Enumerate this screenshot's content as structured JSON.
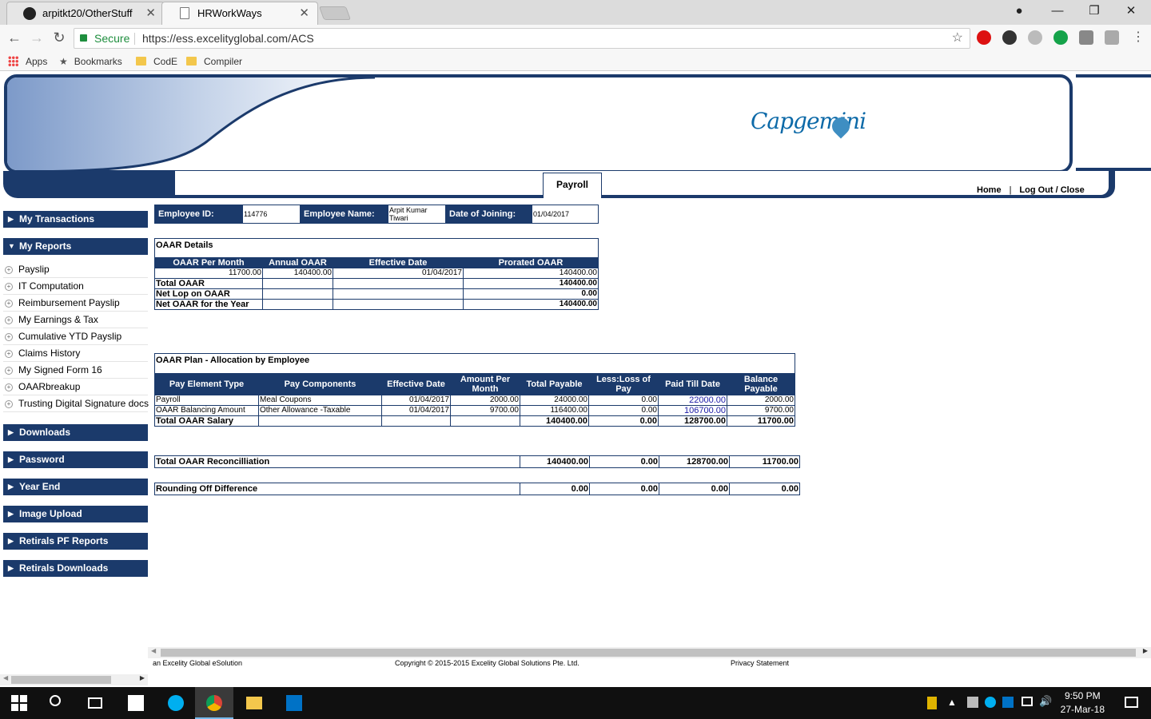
{
  "browser": {
    "tabs": [
      {
        "label": "arpitkt20/OtherStuff",
        "active": false
      },
      {
        "label": "HRWorkWays",
        "active": true
      }
    ],
    "secure_label": "Secure",
    "url": "https://ess.excelityglobal.com/ACS",
    "bookmarks": [
      "Apps",
      "Bookmarks",
      "CodE",
      "Compiler"
    ]
  },
  "header": {
    "logo_text": "Capgemini",
    "active_tab": "Payroll",
    "home_link": "Home",
    "separator": "|",
    "logout_link": "Log Out / Close"
  },
  "sidebar": {
    "sections": [
      {
        "label": "My Transactions",
        "expanded": false
      },
      {
        "label": "My Reports",
        "expanded": true
      },
      {
        "label": "Downloads",
        "expanded": false
      },
      {
        "label": "Password",
        "expanded": false
      },
      {
        "label": "Year End",
        "expanded": false
      },
      {
        "label": "Image Upload",
        "expanded": false
      },
      {
        "label": "Retirals PF Reports",
        "expanded": false
      },
      {
        "label": "Retirals Downloads",
        "expanded": false
      }
    ],
    "report_items": [
      "Payslip",
      "IT Computation",
      "Reimbursement Payslip",
      "My Earnings & Tax",
      "Cumulative YTD Payslip",
      "Claims History",
      "My Signed Form 16",
      "OAARbreakup",
      "Trusting Digital Signature docs"
    ]
  },
  "employee": {
    "id_label": "Employee ID:",
    "id": "114776",
    "name_label": "Employee Name:",
    "name_line1": "Arpit Kumar",
    "name_line2": "Tiwari",
    "doj_label": "Date of Joining:",
    "doj": "01/04/2017"
  },
  "oaar_details": {
    "title": "OAAR Details",
    "headers": [
      "OAAR Per Month",
      "Annual OAAR",
      "Effective Date",
      "Prorated OAAR"
    ],
    "row": [
      "11700.00",
      "140400.00",
      "01/04/2017",
      "140400.00"
    ],
    "totals": [
      {
        "label": "Total OAAR",
        "value": "140400.00"
      },
      {
        "label": "Net Lop on OAAR",
        "value": "0.00"
      },
      {
        "label": "Net OAAR for the Year",
        "value": "140400.00"
      }
    ]
  },
  "oaar_plan": {
    "title": "OAAR Plan - Allocation by Employee",
    "headers": [
      "Pay Element Type",
      "Pay Components",
      "Effective Date",
      "Amount Per Month",
      "Total Payable",
      "Less:Loss of Pay",
      "Paid Till Date",
      "Balance Payable"
    ],
    "rows": [
      [
        "Payroll",
        "Meal Coupons",
        "01/04/2017",
        "2000.00",
        "24000.00",
        "0.00",
        "22000.00",
        "2000.00"
      ],
      [
        "OAAR Balancing Amount",
        "Other Allowance -Taxable",
        "01/04/2017",
        "9700.00",
        "116400.00",
        "0.00",
        "106700.00",
        "9700.00"
      ]
    ],
    "total": [
      "Total OAAR Salary",
      "140400.00",
      "0.00",
      "128700.00",
      "11700.00"
    ]
  },
  "reconciliation": {
    "label": "Total OAAR Reconcilliation",
    "values": [
      "140400.00",
      "0.00",
      "128700.00",
      "11700.00"
    ]
  },
  "rounding": {
    "label": "Rounding Off Difference",
    "values": [
      "0.00",
      "0.00",
      "0.00",
      "0.00"
    ]
  },
  "footer": {
    "left": "an Excelity Global eSolution",
    "center": "Copyright © 2015-2015 Excelity Global Solutions Pte. Ltd.",
    "right": "Privacy Statement"
  },
  "taskbar": {
    "time": "9:50 PM",
    "date": "27-Mar-18"
  },
  "colors": {
    "brand_navy": "#1b3a6b",
    "link_blue": "#1a1aa6",
    "secure_green": "#1e8e3e"
  }
}
